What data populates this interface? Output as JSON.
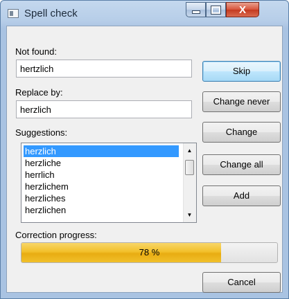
{
  "window": {
    "title": "Spell check",
    "close_glyph": "X"
  },
  "form": {
    "not_found_label": "Not found:",
    "not_found_value": "hertzlich",
    "replace_label": "Replace by:",
    "replace_value": "herzlich",
    "suggestions_label": "Suggestions:",
    "suggestions": [
      "herzlich",
      "herzliche",
      "herrlich",
      "herzlichem",
      "herzliches",
      "herzlichen"
    ],
    "selected_index": 0
  },
  "buttons": {
    "skip": "Skip",
    "change_never": "Change never",
    "change": "Change",
    "change_all": "Change all",
    "add": "Add",
    "cancel": "Cancel"
  },
  "progress": {
    "label": "Correction progress:",
    "value": 0.78,
    "text": "78 %"
  },
  "colors": {
    "selection": "#3399ff",
    "progress_fill": "#f2c02b"
  }
}
